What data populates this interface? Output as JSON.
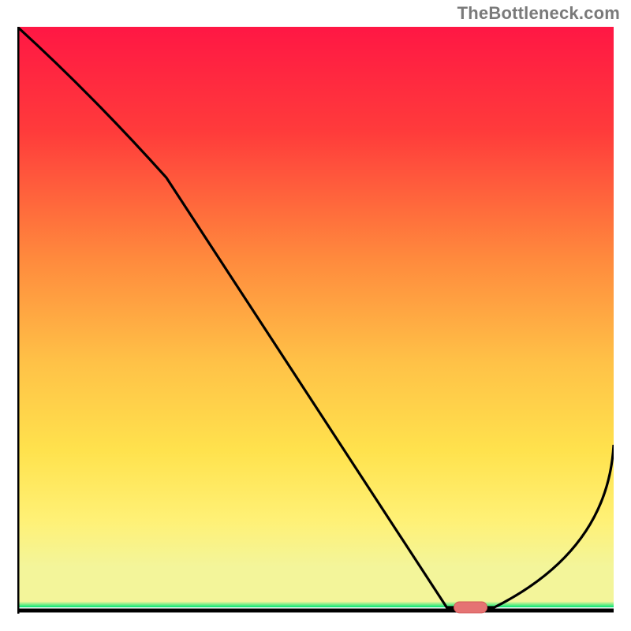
{
  "watermark": "TheBottleneck.com",
  "colors": {
    "curve": "#000000",
    "marker_fill": "#e57373",
    "marker_stroke": "#d45858",
    "axis": "#000000",
    "grad_top": "#ff1744",
    "grad_upper": "#ff3b3b",
    "grad_mid_high": "#ff8a3d",
    "grad_mid": "#ffc247",
    "grad_mid_low": "#ffe24d",
    "grad_low": "#fff176",
    "grad_lower": "#f3f59a",
    "grad_bottom": "#00e676"
  },
  "chart_data": {
    "type": "line",
    "title": "",
    "xlabel": "",
    "ylabel": "",
    "xlim": [
      0,
      100
    ],
    "ylim": [
      0,
      100
    ],
    "x": [
      0,
      25,
      72,
      80,
      100
    ],
    "y": [
      100,
      74,
      0,
      0,
      28
    ],
    "marker": {
      "x_center": 76,
      "y": 0
    },
    "note": "V-shaped bottleneck curve; deep minimum near x≈76, rising again toward right edge. Values read from geometry as percentages of axis range."
  }
}
